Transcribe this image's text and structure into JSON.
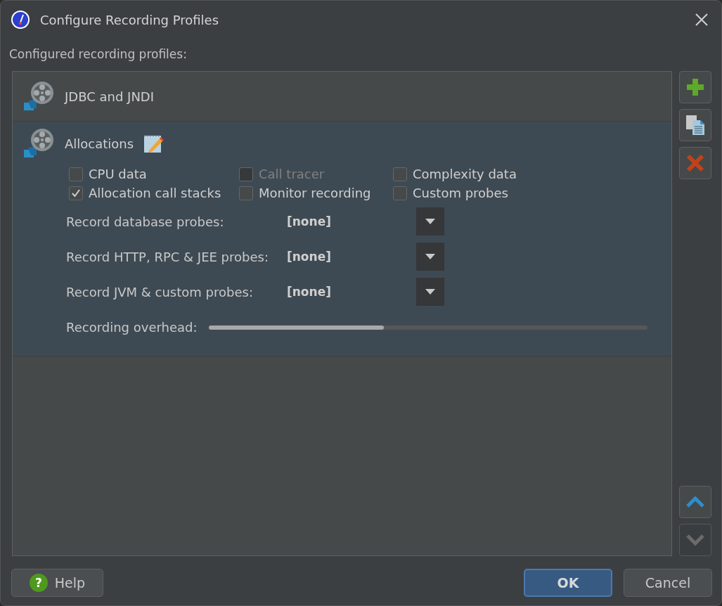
{
  "window": {
    "title": "Configure Recording Profiles"
  },
  "list_label": "Configured recording profiles:",
  "profiles": [
    {
      "name": "JDBC and JNDI",
      "selected": false
    },
    {
      "name": "Allocations",
      "selected": true,
      "editable": true,
      "options": [
        {
          "label": "CPU data",
          "checked": false,
          "disabled": false
        },
        {
          "label": "Call tracer",
          "checked": false,
          "disabled": true
        },
        {
          "label": "Complexity data",
          "checked": false,
          "disabled": false
        },
        {
          "label": "Allocation call stacks",
          "checked": true,
          "disabled": false
        },
        {
          "label": "Monitor recording",
          "checked": false,
          "disabled": false
        },
        {
          "label": "Custom probes",
          "checked": false,
          "disabled": false
        }
      ],
      "probes": [
        {
          "label": "Record database probes:",
          "value": "[none]"
        },
        {
          "label": "Record HTTP, RPC & JEE probes:",
          "value": "[none]"
        },
        {
          "label": "Record JVM & custom probes:",
          "value": "[none]"
        }
      ],
      "overhead": {
        "label": "Recording overhead:",
        "level": 0.4
      }
    }
  ],
  "side_buttons": [
    {
      "kind": "add",
      "disabled": false
    },
    {
      "kind": "copy",
      "disabled": false
    },
    {
      "kind": "delete",
      "disabled": false
    },
    {
      "kind": "up",
      "disabled": false
    },
    {
      "kind": "down",
      "disabled": true
    }
  ],
  "help_button": {
    "icon": "?",
    "label": "Help"
  },
  "buttons": [
    {
      "label": "OK",
      "default": true
    },
    {
      "label": "Cancel",
      "default": false
    }
  ]
}
